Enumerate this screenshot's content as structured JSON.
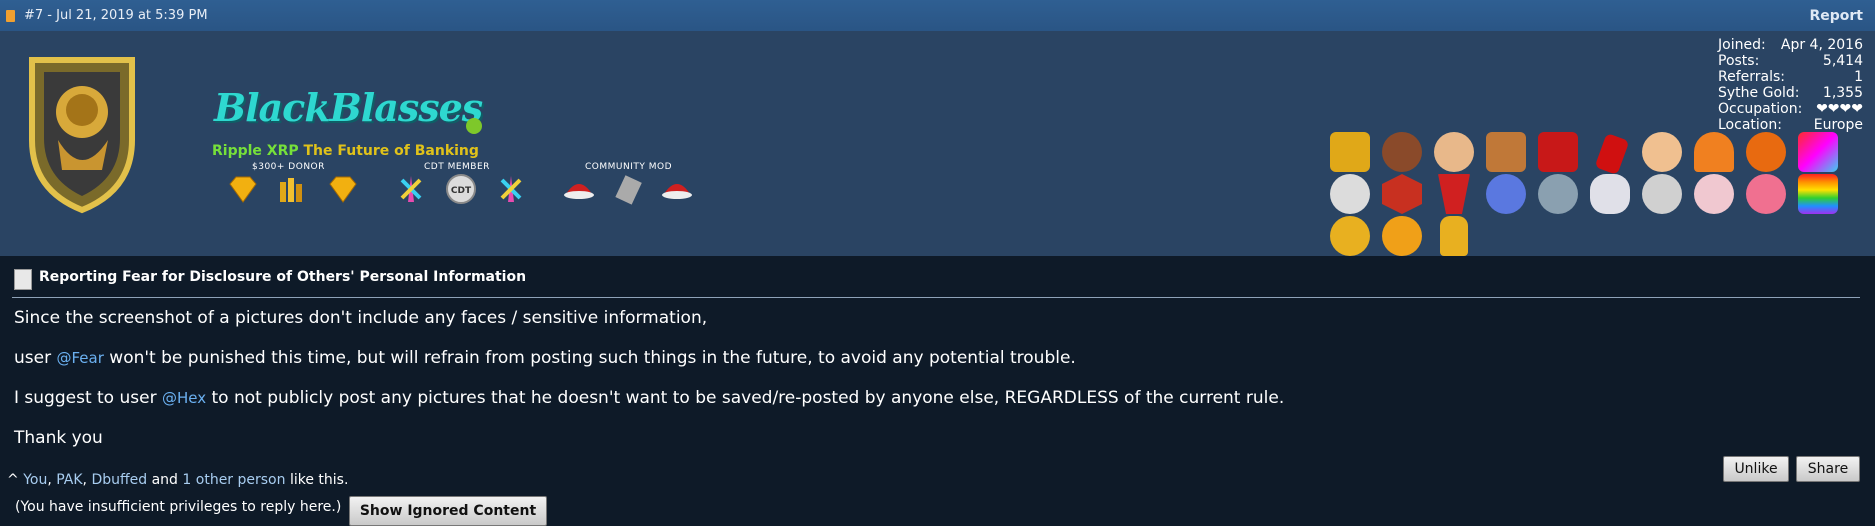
{
  "post_header": {
    "number_date": "#7 - Jul 21, 2019 at 5:39 PM",
    "report_label": "Report"
  },
  "user": {
    "username": "BlackBlasses",
    "title_xrp": "Ripple XRP",
    "title_rest": " The Future of Banking",
    "badge_groups": [
      "$300+ DONOR",
      "CDT MEMBER",
      "COMMUNITY MOD"
    ]
  },
  "stats": [
    {
      "label": "Joined:",
      "value": "Apr 4, 2016"
    },
    {
      "label": "Posts:",
      "value": "5,414"
    },
    {
      "label": "Referrals:",
      "value": "1"
    },
    {
      "label": "Sythe Gold:",
      "value": "1,355"
    },
    {
      "label": "Occupation:",
      "value": "❤❤❤❤"
    },
    {
      "label": "Location:",
      "value": "Europe"
    }
  ],
  "thread": {
    "title": "Reporting Fear for Disclosure of Others' Personal Information"
  },
  "message": {
    "line1": "Since the screenshot of a pictures don't include any faces / sensitive information,",
    "line2_pre": "user ",
    "line2_mention": "@Fear",
    "line2_post": " won't be punished this time, but will refrain from posting such things in the future, to avoid any potential trouble.",
    "line3_pre": "I suggest to user ",
    "line3_mention": "@Hex",
    "line3_post": " to not publicly post any pictures that he doesn't want to be saved/re-posted by anyone else, REGARDLESS of the current rule.",
    "line4": "Thank you"
  },
  "likes": {
    "prefix": "^ ",
    "you": "You",
    "sep1": ", ",
    "user1": "PAK",
    "sep2": ", ",
    "user2": "Dbuffed",
    "and": " and ",
    "count": "1",
    "other": " other person",
    "suffix": " like this."
  },
  "actions": {
    "unlike": "Unlike",
    "share": "Share"
  },
  "footer": {
    "privileges": "(You have insufficient privileges to reply here.)",
    "show_ignored": "Show Ignored Content"
  },
  "colors": {
    "header_bar": "#2f5f92",
    "profile_bg": "#2a4463",
    "content_bg": "#0e1a28",
    "username": "#2ed8d0",
    "mention": "#6bb0f0"
  }
}
